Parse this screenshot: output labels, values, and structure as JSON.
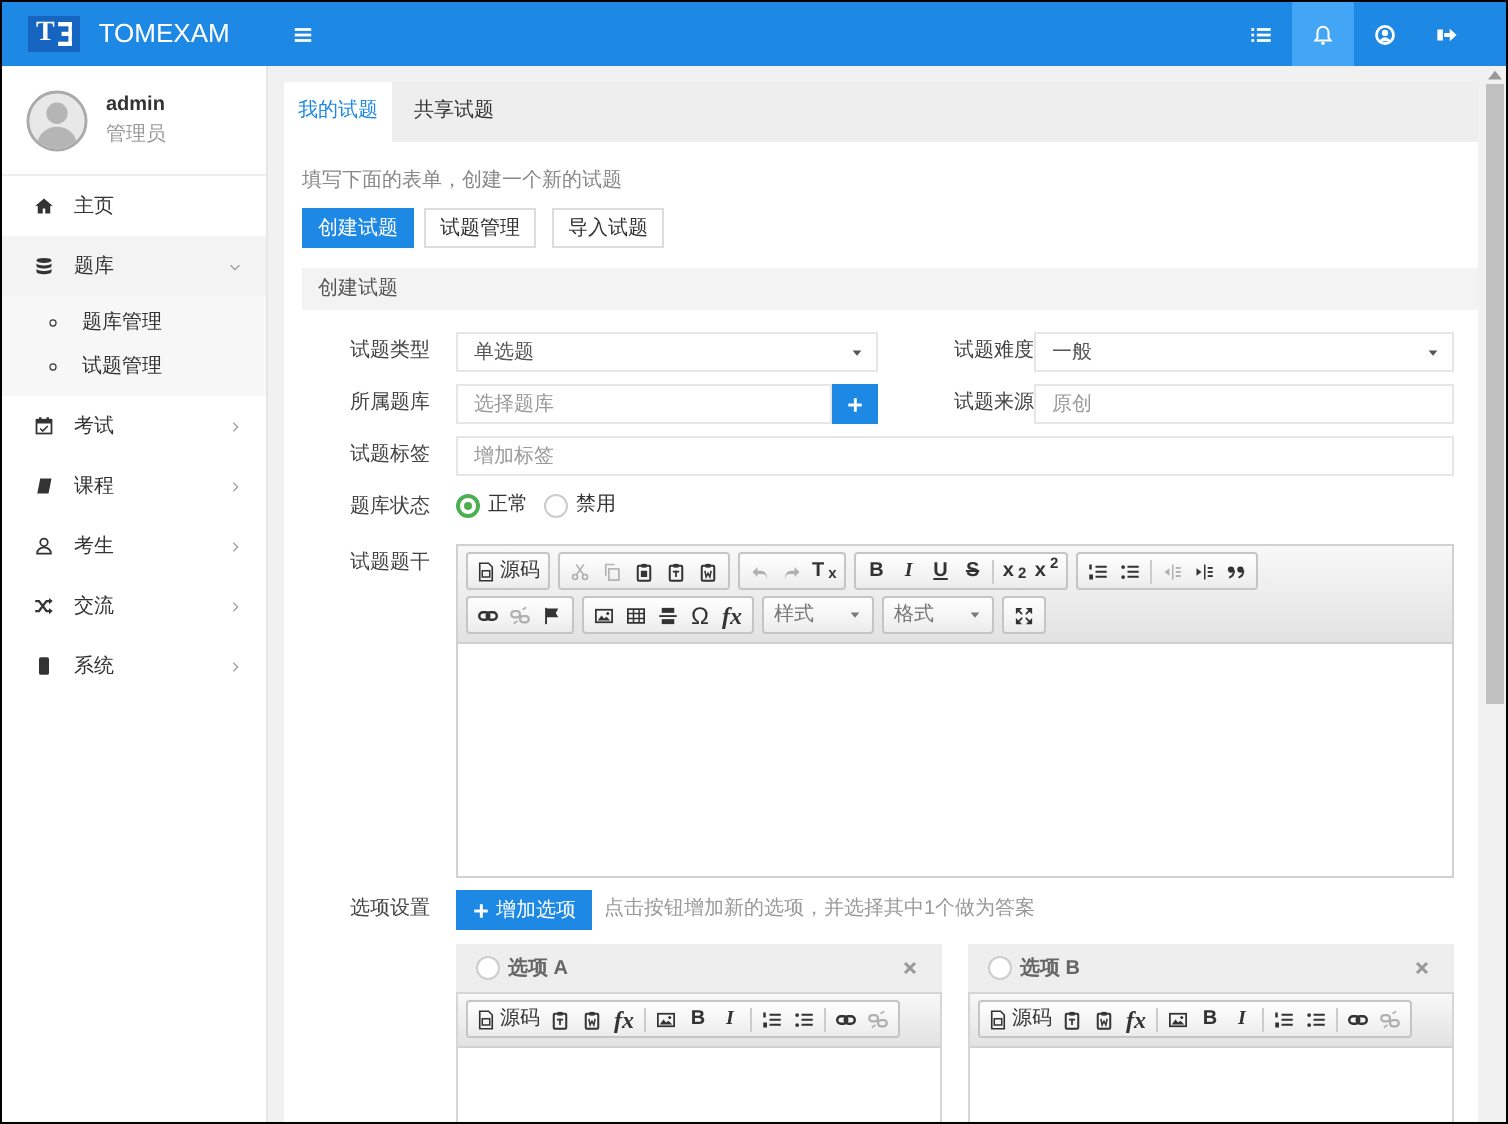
{
  "brand": {
    "mark": "T",
    "name": "TOMEXAM"
  },
  "topbar": {
    "icons": [
      {
        "kind": "list",
        "selected": false
      },
      {
        "kind": "bell",
        "selected": true
      },
      {
        "kind": "user-circle",
        "selected": false
      },
      {
        "kind": "logout",
        "selected": false
      }
    ]
  },
  "profile": {
    "name": "admin",
    "role": "管理员"
  },
  "sidebar": {
    "items": [
      {
        "kind": "home",
        "label": "主页"
      },
      {
        "kind": "database",
        "label": "题库",
        "expanded": true,
        "children": [
          {
            "label": "题库管理"
          },
          {
            "label": "试题管理"
          }
        ]
      },
      {
        "kind": "calendar",
        "label": "考试",
        "expanded": false
      },
      {
        "kind": "book",
        "label": "课程",
        "expanded": false
      },
      {
        "kind": "user",
        "label": "考生",
        "expanded": false
      },
      {
        "kind": "shuffle",
        "label": "交流",
        "expanded": false
      },
      {
        "kind": "system",
        "label": "系统",
        "expanded": false
      }
    ]
  },
  "tabs": [
    {
      "label": "我的试题",
      "selected": true
    },
    {
      "label": "共享试题",
      "selected": false
    }
  ],
  "intro": "填写下面的表单，创建一个新的试题",
  "actions": [
    {
      "label": "创建试题",
      "kind": "primary"
    },
    {
      "label": "试题管理",
      "kind": "default"
    },
    {
      "label": "导入试题",
      "kind": "default"
    }
  ],
  "section_title": "创建试题",
  "form": {
    "rows": [
      [
        {
          "kind": "select",
          "label": "试题类型",
          "value": "单选题"
        },
        {
          "kind": "select",
          "label": "试题难度",
          "value": "一般"
        }
      ],
      [
        {
          "kind": "input-add",
          "label": "所属题库",
          "placeholder": "选择题库"
        },
        {
          "kind": "input",
          "label": "试题来源",
          "placeholder": "原创"
        }
      ],
      [
        {
          "kind": "input",
          "label": "试题标签",
          "placeholder": "增加标签"
        }
      ],
      [
        {
          "kind": "radio",
          "label": "题库状态",
          "options": [
            {
              "label": "正常",
              "selected": true
            },
            {
              "label": "禁用",
              "selected": false
            }
          ]
        }
      ],
      [
        {
          "kind": "editor",
          "label": "试题题干",
          "toolbar": [
            [
              {
                "kind": "group",
                "items": [
                  {
                    "kind": "source",
                    "label": "源码",
                    "disabled": false
                  }
                ]
              },
              {
                "kind": "group",
                "items": [
                  {
                    "kind": "cut",
                    "disabled": true
                  },
                  {
                    "kind": "copy",
                    "disabled": true
                  },
                  {
                    "kind": "paste",
                    "disabled": false
                  },
                  {
                    "kind": "paste-text",
                    "disabled": false
                  },
                  {
                    "kind": "paste-word",
                    "disabled": false
                  }
                ]
              },
              {
                "kind": "group",
                "items": [
                  {
                    "kind": "undo",
                    "disabled": true
                  },
                  {
                    "kind": "redo",
                    "disabled": true
                  },
                  {
                    "kind": "rich",
                    "label": "T$_{x}$",
                    "disabled": false
                  }
                ]
              },
              {
                "kind": "group",
                "items": [
                  {
                    "kind": "bold",
                    "label": "B",
                    "disabled": false
                  },
                  {
                    "kind": "italic",
                    "label": "I",
                    "disabled": false
                  },
                  {
                    "kind": "underline",
                    "label": "U",
                    "disabled": false
                  },
                  {
                    "kind": "strike",
                    "label": "S",
                    "disabled": false
                  },
                  {
                    "kind": "sep"
                  },
                  {
                    "kind": "rich",
                    "label": "x$_{2}$",
                    "disabled": false
                  },
                  {
                    "kind": "rich",
                    "label": "x$^{2}$",
                    "disabled": false
                  }
                ]
              },
              {
                "kind": "group",
                "items": [
                  {
                    "kind": "ol",
                    "disabled": false
                  },
                  {
                    "kind": "ul",
                    "disabled": false
                  },
                  {
                    "kind": "sep"
                  },
                  {
                    "kind": "outdent",
                    "disabled": true
                  },
                  {
                    "kind": "indent",
                    "disabled": false
                  },
                  {
                    "kind": "blockquote",
                    "disabled": false
                  }
                ]
              }
            ],
            [
              {
                "kind": "group",
                "items": [
                  {
                    "kind": "link",
                    "disabled": false
                  },
                  {
                    "kind": "unlink",
                    "disabled": true
                  },
                  {
                    "kind": "anchor",
                    "disabled": false
                  }
                ]
              },
              {
                "kind": "group",
                "items": [
                  {
                    "kind": "image",
                    "disabled": false
                  },
                  {
                    "kind": "table",
                    "disabled": false
                  },
                  {
                    "kind": "hr",
                    "disabled": false
                  },
                  {
                    "kind": "text",
                    "label": "Ω",
                    "disabled": false
                  },
                  {
                    "kind": "formula",
                    "label": "fx",
                    "disabled": false
                  }
                ]
              },
              {
                "kind": "dropdown",
                "label": "样式"
              },
              {
                "kind": "dropdown",
                "label": "格式"
              },
              {
                "kind": "group",
                "items": [
                  {
                    "kind": "maximize",
                    "disabled": false
                  }
                ]
              }
            ]
          ]
        }
      ],
      [
        {
          "kind": "options",
          "label": "选项设置",
          "button": "增加选项",
          "hint": "点击按钮增加新的选项，并选择其中1个做为答案",
          "cards": [
            {
              "title": "选项 A",
              "selected": false,
              "toolbar": [
                [
                  {
                    "kind": "group",
                    "items": [
                      {
                        "kind": "source",
                        "label": "源码",
                        "disabled": false
                      },
                      {
                        "kind": "paste-text",
                        "disabled": false
                      },
                      {
                        "kind": "paste-word",
                        "disabled": false
                      },
                      {
                        "kind": "formula",
                        "label": "fx",
                        "disabled": false
                      },
                      {
                        "kind": "sep"
                      },
                      {
                        "kind": "image",
                        "disabled": false
                      },
                      {
                        "kind": "bold",
                        "label": "B",
                        "disabled": false
                      },
                      {
                        "kind": "italic",
                        "label": "I",
                        "disabled": false
                      },
                      {
                        "kind": "sep"
                      },
                      {
                        "kind": "ol",
                        "disabled": false
                      },
                      {
                        "kind": "ul",
                        "disabled": false
                      },
                      {
                        "kind": "sep"
                      },
                      {
                        "kind": "link",
                        "disabled": false
                      },
                      {
                        "kind": "unlink",
                        "disabled": true
                      }
                    ]
                  }
                ]
              ]
            },
            {
              "title": "选项 B",
              "selected": false,
              "toolbar": [
                [
                  {
                    "kind": "group",
                    "items": [
                      {
                        "kind": "source",
                        "label": "源码",
                        "disabled": false
                      },
                      {
                        "kind": "paste-text",
                        "disabled": false
                      },
                      {
                        "kind": "paste-word",
                        "disabled": false
                      },
                      {
                        "kind": "formula",
                        "label": "fx",
                        "disabled": false
                      },
                      {
                        "kind": "sep"
                      },
                      {
                        "kind": "image",
                        "disabled": false
                      },
                      {
                        "kind": "bold",
                        "label": "B",
                        "disabled": false
                      },
                      {
                        "kind": "italic",
                        "label": "I",
                        "disabled": false
                      },
                      {
                        "kind": "sep"
                      },
                      {
                        "kind": "ol",
                        "disabled": false
                      },
                      {
                        "kind": "ul",
                        "disabled": false
                      },
                      {
                        "kind": "sep"
                      },
                      {
                        "kind": "link",
                        "disabled": false
                      },
                      {
                        "kind": "unlink",
                        "disabled": true
                      }
                    ]
                  }
                ]
              ]
            }
          ]
        }
      ]
    ]
  }
}
